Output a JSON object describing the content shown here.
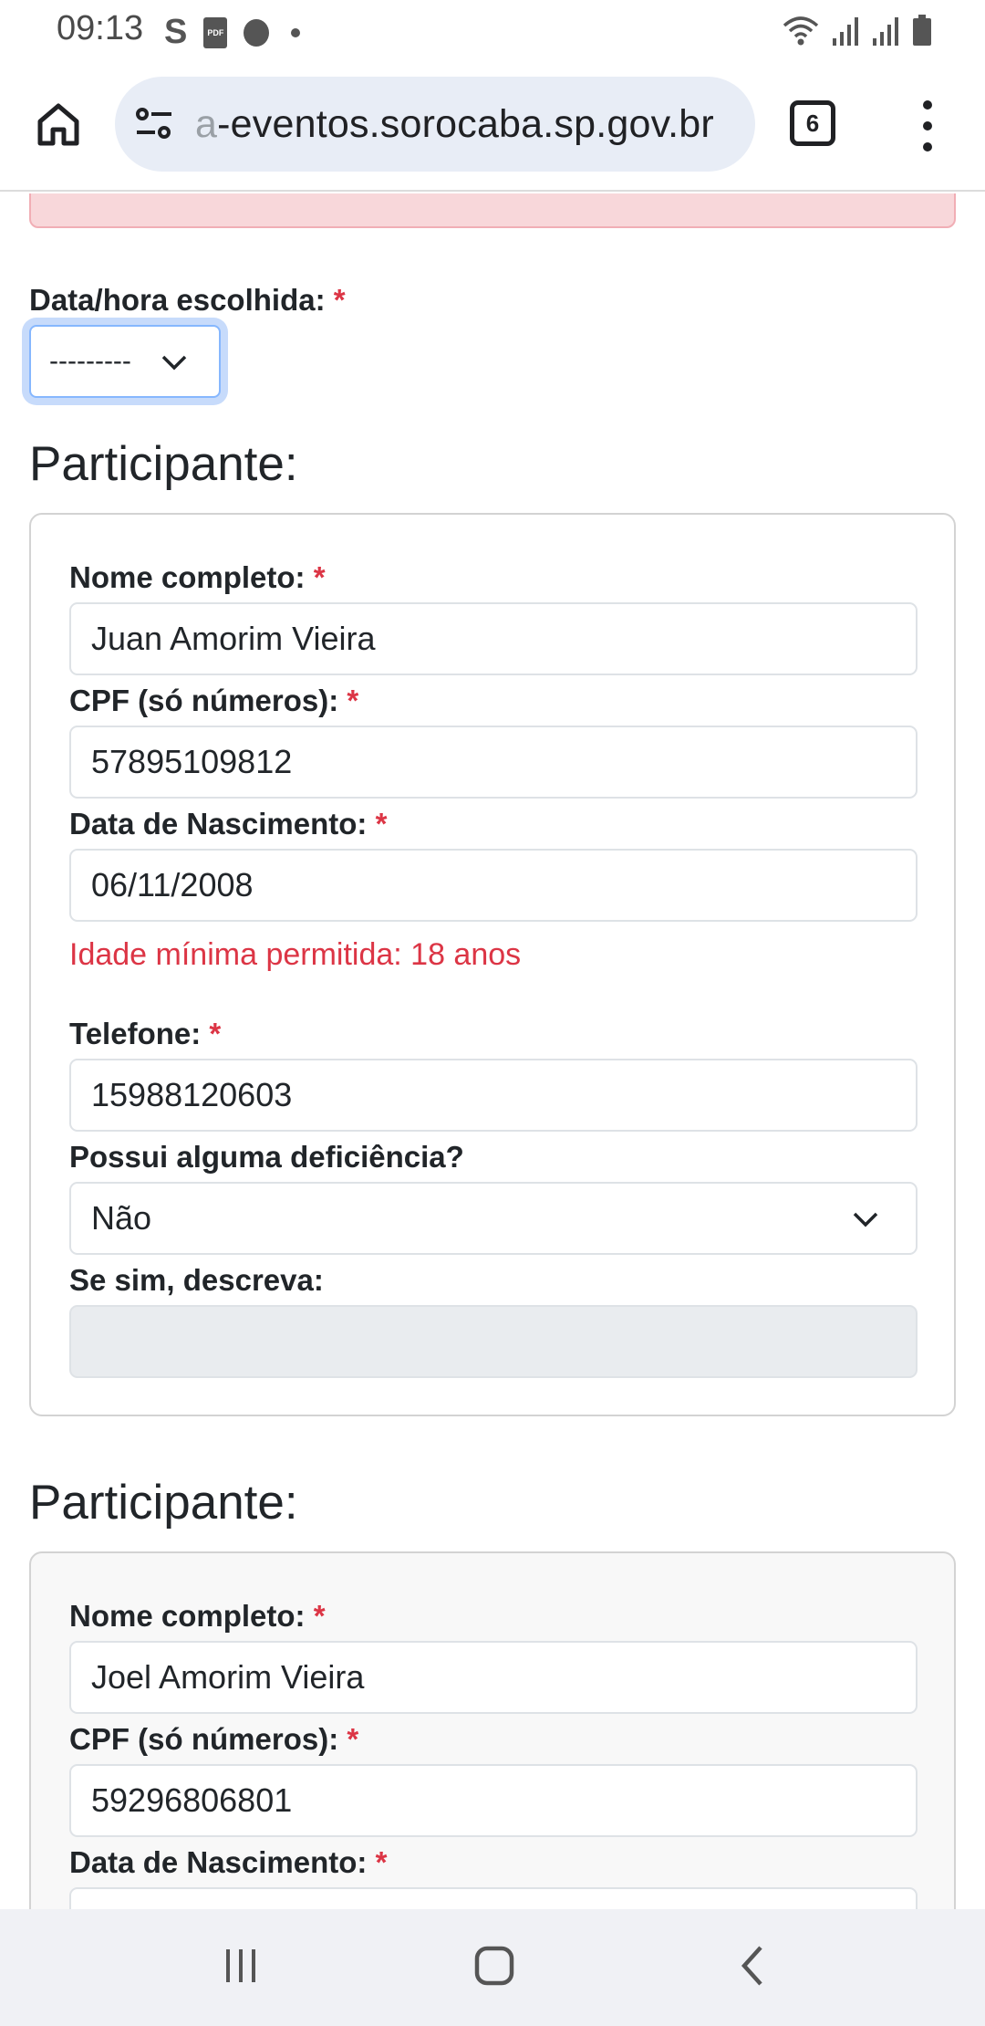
{
  "status_bar": {
    "time": "09:13",
    "left_icons": [
      "s-app-icon",
      "pdf-icon",
      "app-icon",
      "dot"
    ],
    "right_icons": [
      "wifi-icon",
      "signal-icon",
      "signal-icon",
      "battery-icon"
    ]
  },
  "browser": {
    "url_faded_prefix": "a",
    "url": "-eventos.sorocaba.sp.gov.br",
    "tab_count": "6"
  },
  "form": {
    "datetime_label": "Data/hora escolhida:",
    "required_mark": "*",
    "datetime_value": "---------",
    "participants": [
      {
        "section_title": "Participante:",
        "name_label": "Nome completo:",
        "name_value": "Juan Amorim Vieira",
        "cpf_label": "CPF (só números):",
        "cpf_value": "57895109812",
        "birth_label": "Data de Nascimento:",
        "birth_value": "06/11/2008",
        "birth_error": "Idade mínima permitida: 18 anos",
        "phone_label": "Telefone:",
        "phone_value": "15988120603",
        "disability_label": "Possui alguma deficiência?",
        "disability_value": "Não",
        "describe_label": "Se sim, descreva:",
        "describe_value": ""
      },
      {
        "section_title": "Participante:",
        "name_label": "Nome completo:",
        "name_value": "Joel Amorim Vieira",
        "cpf_label": "CPF (só números):",
        "cpf_value": "59296806801",
        "birth_label": "Data de Nascimento:"
      }
    ]
  },
  "colors": {
    "required": "#dc3545",
    "error": "#dc3545",
    "alert_bg": "#f8d7da",
    "focus_ring": "#86b7fe"
  }
}
